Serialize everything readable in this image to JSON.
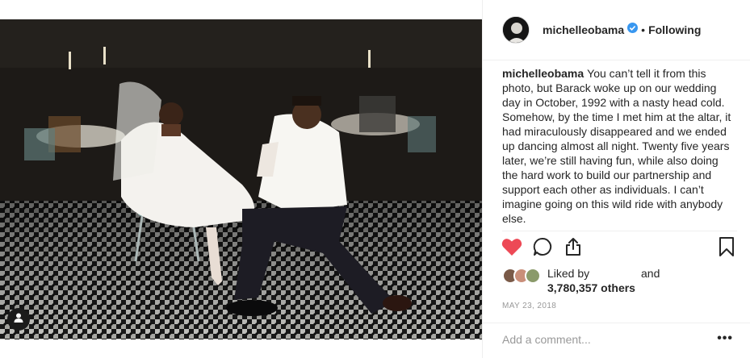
{
  "post": {
    "photo_alt": "",
    "header": {
      "username": "michelleobama",
      "separator": "•",
      "follow_state": "Following"
    },
    "caption": {
      "username": "michelleobama",
      "text": "You can’t tell it from this photo, but Barack woke up on our wedding day in October, 1992 with a nasty head cold. Somehow, by the time I met him at the altar, it had miraculously disappeared and we ended up dancing almost all night. Twenty five years later, we’re still having fun, while also doing the hard work to build our partnership and support each other as individuals. I can’t imagine going on this wild ride with anybody else."
    },
    "likes": {
      "liked_by": "Liked by",
      "and": "and",
      "count": "3,780,357 others"
    },
    "date": "MAY 23, 2018",
    "comment": {
      "placeholder": "Add a comment...",
      "more": "•••"
    },
    "icons": {
      "like": "heart-filled-icon",
      "comment": "speech-bubble-icon",
      "share": "share-icon",
      "save": "bookmark-icon",
      "verified": "verified-badge-icon",
      "user_tag": "user-tag-icon"
    },
    "colors": {
      "heart": "#ed4956",
      "verified": "#3897f0",
      "muted": "#999999",
      "text": "#262626"
    }
  }
}
